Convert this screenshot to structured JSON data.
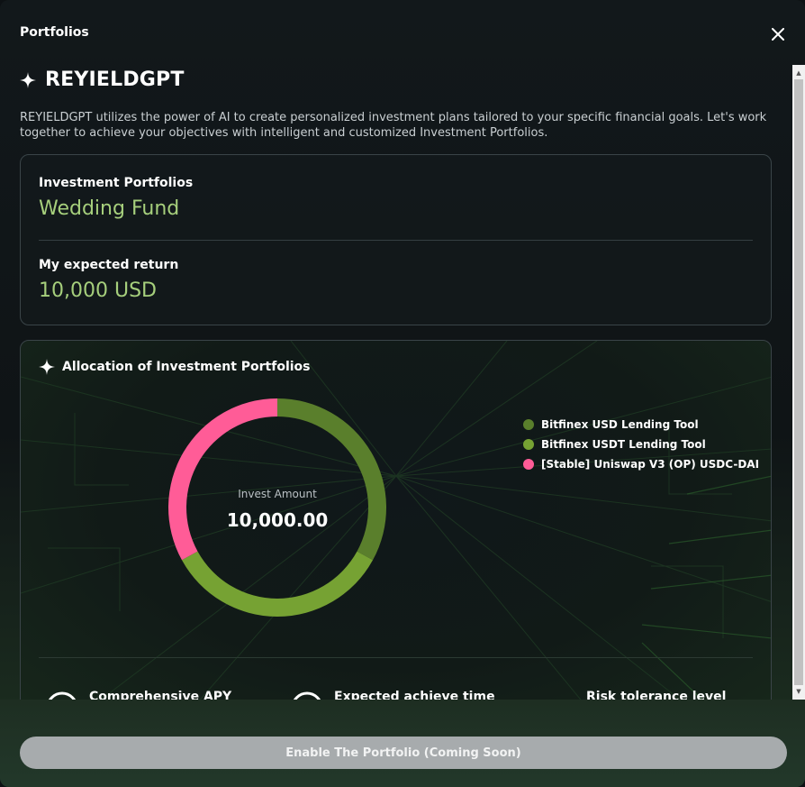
{
  "modal": {
    "title": "Portfolios"
  },
  "brand": {
    "name": "REYIELDGPT",
    "intro": "REYIELDGPT utilizes the power of AI to create personalized investment plans tailored to your specific financial goals. Let's work together to achieve your objectives with intelligent and customized Investment Portfolios."
  },
  "summary": {
    "portfolio_label": "Investment Portfolios",
    "portfolio_value": "Wedding Fund",
    "return_label": "My expected return",
    "return_value": "10,000 USD"
  },
  "allocation": {
    "title": "Allocation of Investment Portfolios",
    "center_label": "Invest Amount",
    "center_value": "10,000.00",
    "legend": [
      {
        "label": "Bitfinex USD Lending Tool",
        "color": "#5a7f2c"
      },
      {
        "label": "Bitfinex USDT Lending Tool",
        "color": "#76a233"
      },
      {
        "label": "[Stable] Uniswap V3 (OP) USDC-DAI",
        "color": "#ff5c97"
      }
    ],
    "metrics": [
      {
        "label": "Comprehensive APY"
      },
      {
        "label": "Expected achieve time"
      },
      {
        "label": "Risk tolerance level"
      }
    ]
  },
  "chart_data": {
    "type": "pie",
    "categories": [
      "Bitfinex USD Lending Tool",
      "Bitfinex USDT Lending Tool",
      "[Stable] Uniswap V3 (OP) USDC-DAI"
    ],
    "values": [
      0.33,
      0.34,
      0.33
    ],
    "colors": [
      "#5a7f2c",
      "#76a233",
      "#ff5c97"
    ],
    "donut": true,
    "center_label": "Invest Amount",
    "center_value": "10,000.00"
  },
  "footer": {
    "enable_button": "Enable The Portfolio (Coming Soon)"
  }
}
